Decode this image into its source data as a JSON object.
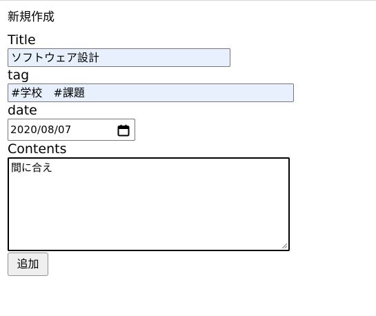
{
  "page": {
    "heading": "新規作成"
  },
  "form": {
    "title_label": "Title",
    "title_value": "ソフトウェア設計",
    "tag_label": "tag",
    "tag_value": "#学校　#課題",
    "date_label": "date",
    "date_value": "2020/08/07",
    "contents_label": "Contents",
    "contents_value": "間に合え",
    "submit_label": "追加"
  },
  "icons": {
    "date_picker": "calendar-icon",
    "textarea_resize": "resize-handle-icon"
  },
  "colors": {
    "autofill_background": "#e8f0fe",
    "input_border": "#767676",
    "button_background": "#efefef"
  }
}
